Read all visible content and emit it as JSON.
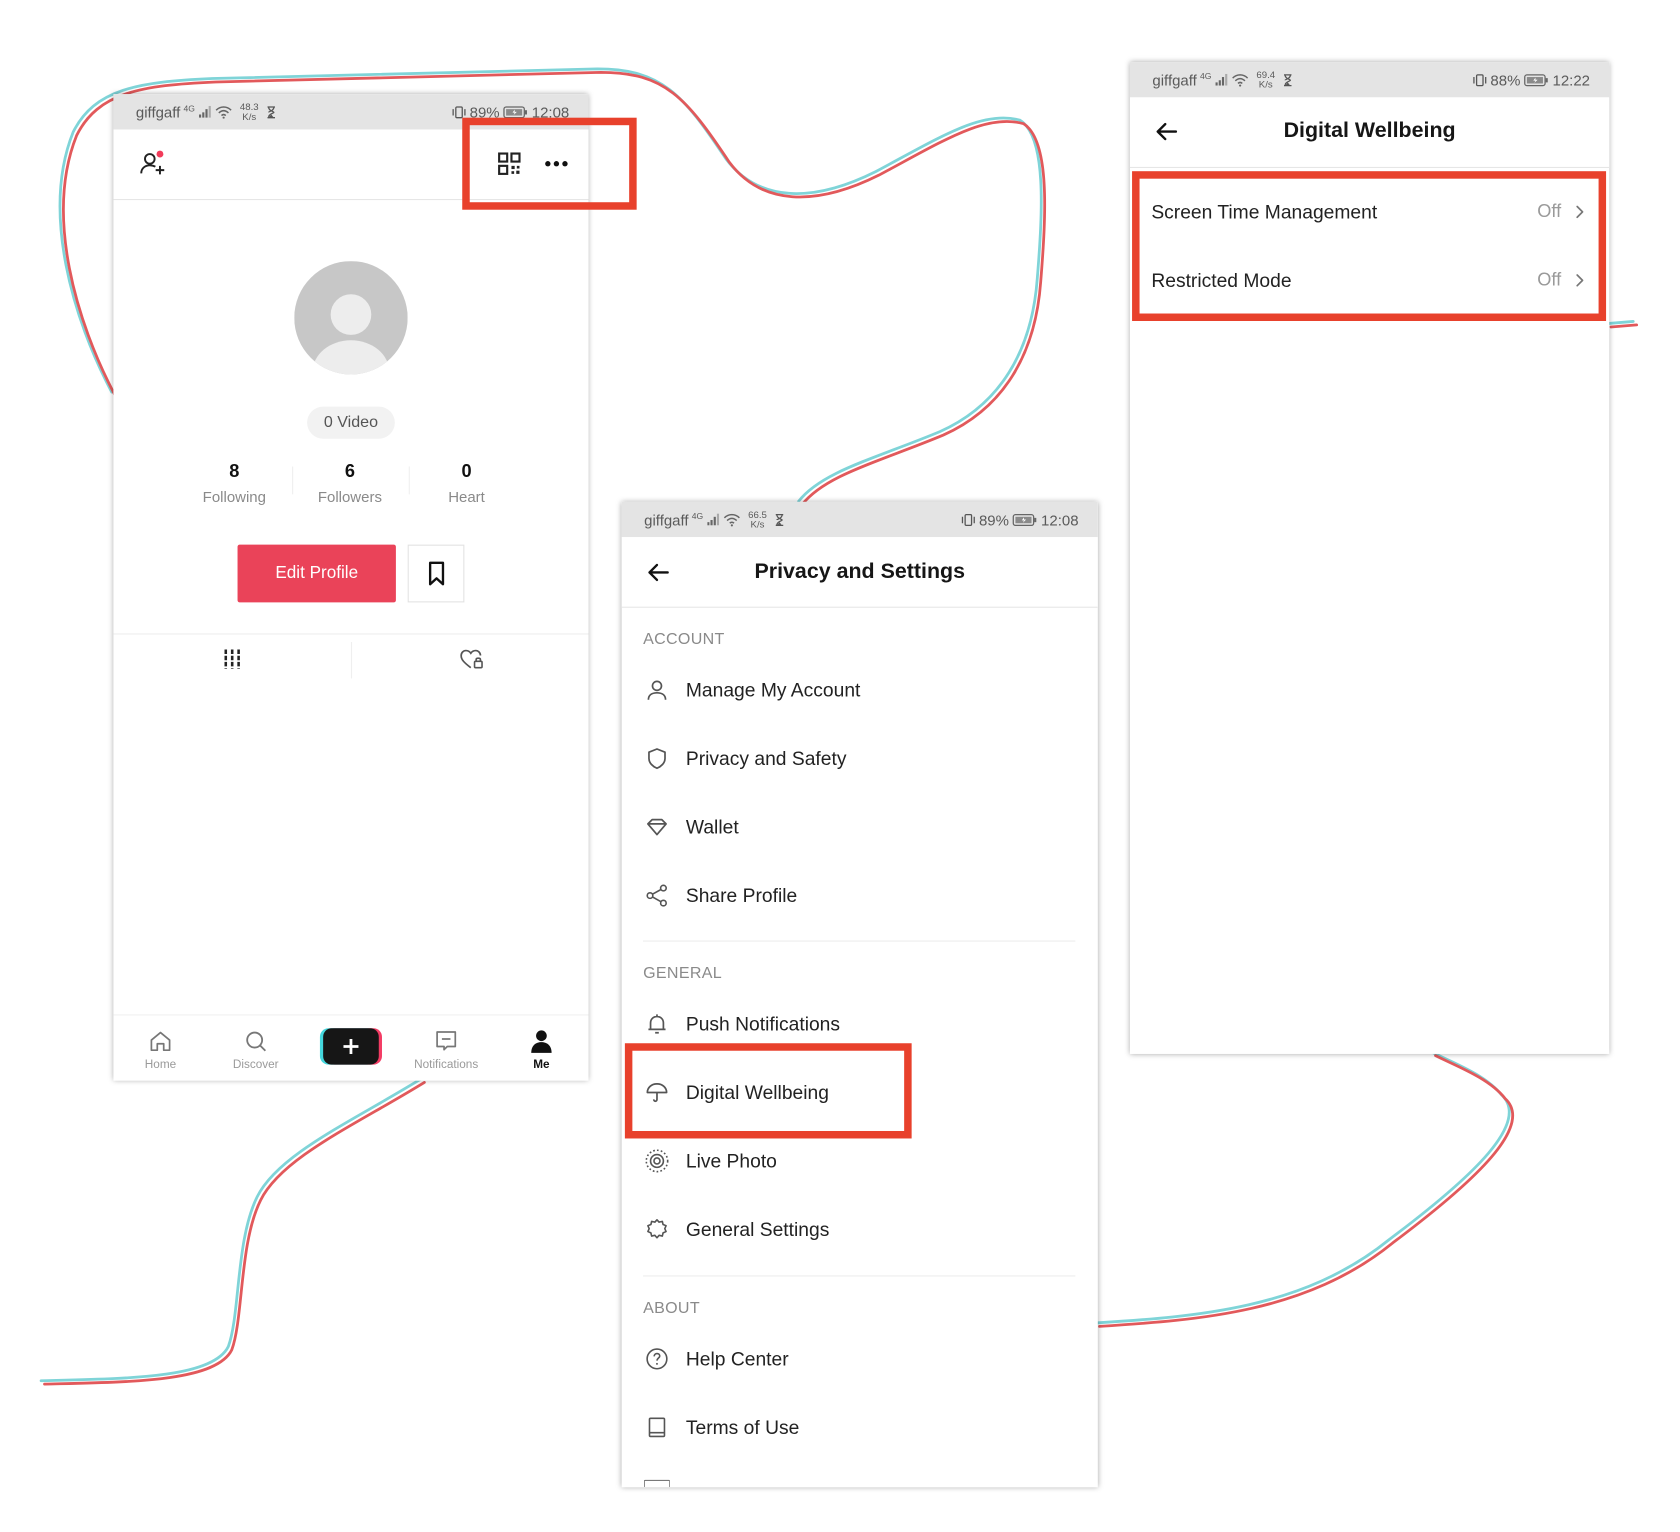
{
  "colors": {
    "highlight_box": "#e8412c",
    "accent": "#ea4359",
    "curve_cyan": "#7fd4d8",
    "curve_red": "#e2595b",
    "status_bar_bg": "#e4e4e4"
  },
  "profile_screen": {
    "status": {
      "carrier": "giffgaff",
      "network": "4G",
      "speed": "48.3",
      "speed_unit": "K/s",
      "battery": "89%",
      "time": "12:08"
    },
    "header": {
      "left_icon": "add-user-icon",
      "right_icons": [
        "qr-code-icon",
        "more-icon"
      ],
      "highlighted": true
    },
    "video_count": "0 Video",
    "stats": [
      {
        "value": "8",
        "label": "Following"
      },
      {
        "value": "6",
        "label": "Followers"
      },
      {
        "value": "0",
        "label": "Heart"
      }
    ],
    "edit_profile_label": "Edit Profile",
    "tabs": [
      "grid-icon",
      "liked-private-icon"
    ],
    "nav": [
      {
        "label": "Home",
        "icon": "home-icon"
      },
      {
        "label": "Discover",
        "icon": "search-icon"
      },
      {
        "icon": "create-plus-icon"
      },
      {
        "label": "Notifications",
        "icon": "inbox-icon"
      },
      {
        "label": "Me",
        "icon": "profile-icon",
        "active": true
      }
    ]
  },
  "settings_screen": {
    "status": {
      "carrier": "giffgaff",
      "network": "4G",
      "speed": "66.5",
      "speed_unit": "K/s",
      "battery": "89%",
      "time": "12:08"
    },
    "title": "Privacy and Settings",
    "sections": [
      {
        "heading": "ACCOUNT",
        "items": [
          {
            "label": "Manage My Account",
            "icon": "person-icon"
          },
          {
            "label": "Privacy and Safety",
            "icon": "shield-icon"
          },
          {
            "label": "Wallet",
            "icon": "diamond-icon"
          },
          {
            "label": "Share Profile",
            "icon": "share-icon"
          }
        ]
      },
      {
        "heading": "GENERAL",
        "items": [
          {
            "label": "Push Notifications",
            "icon": "bell-icon"
          },
          {
            "label": "Digital Wellbeing",
            "icon": "umbrella-icon",
            "highlighted": true
          },
          {
            "label": "Live Photo",
            "icon": "live-photo-icon"
          },
          {
            "label": "General Settings",
            "icon": "gear-icon"
          }
        ]
      },
      {
        "heading": "ABOUT",
        "items": [
          {
            "label": "Help Center",
            "icon": "help-icon"
          },
          {
            "label": "Terms of Use",
            "icon": "book-icon"
          }
        ]
      }
    ]
  },
  "wellbeing_screen": {
    "status": {
      "carrier": "giffgaff",
      "network": "4G",
      "speed": "69.4",
      "speed_unit": "K/s",
      "battery": "88%",
      "time": "12:22"
    },
    "title": "Digital Wellbeing",
    "items": [
      {
        "label": "Screen Time Management",
        "value": "Off",
        "highlighted": true
      },
      {
        "label": "Restricted Mode",
        "value": "Off",
        "highlighted": true
      }
    ]
  }
}
